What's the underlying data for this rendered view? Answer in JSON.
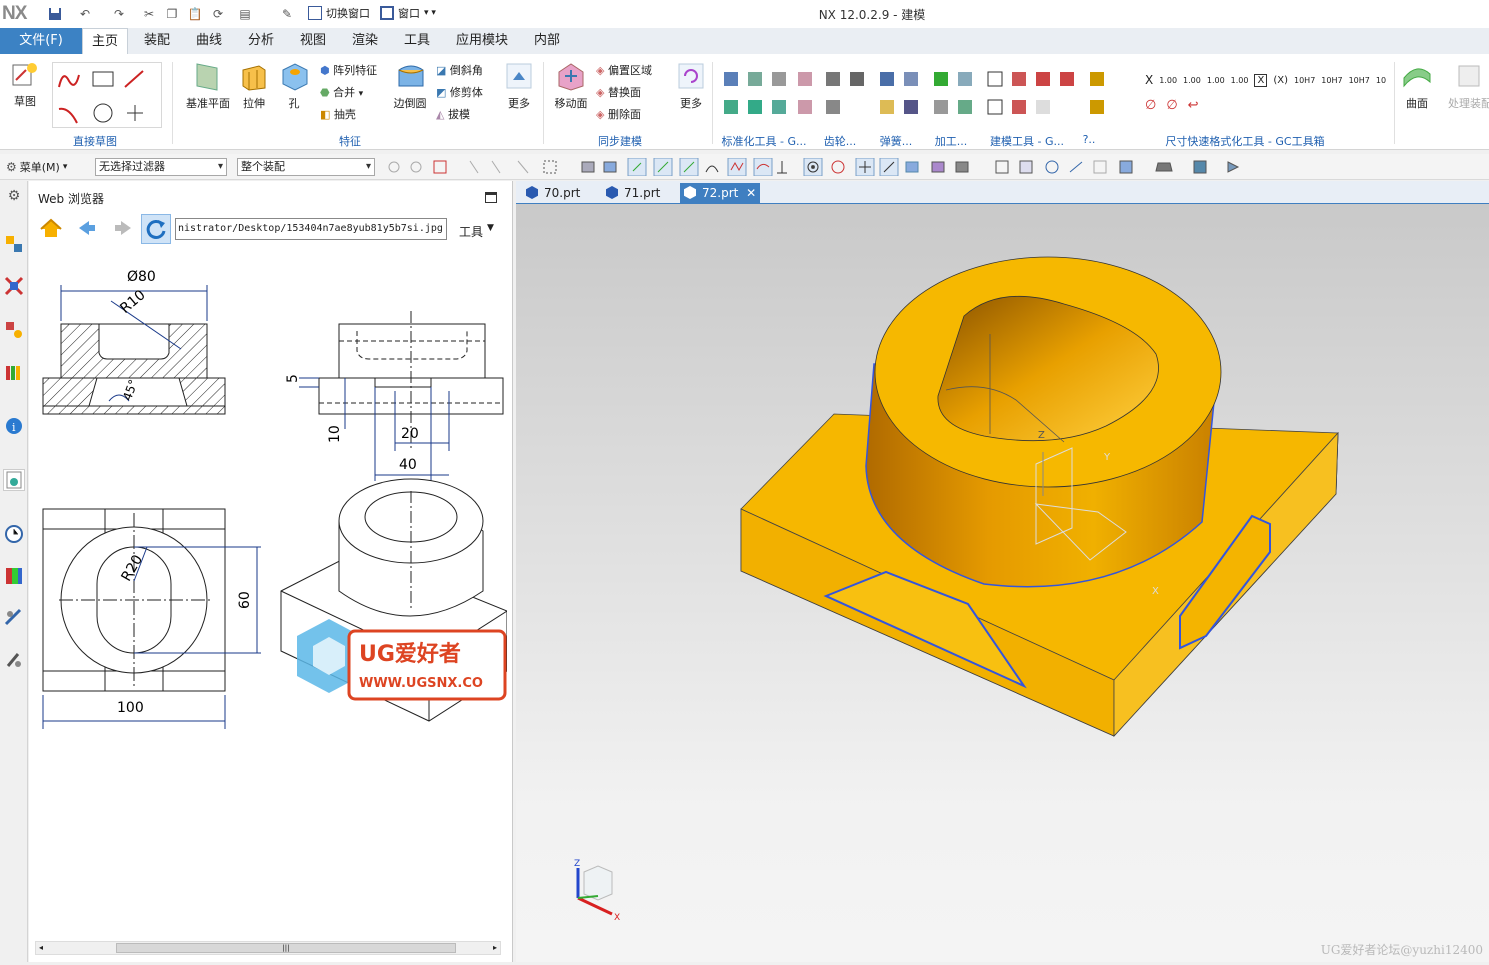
{
  "app": {
    "logo": "NX",
    "title": "NX 12.0.2.9 - 建模"
  },
  "quick_access": {
    "switch_window": "切换窗口",
    "window": "窗口"
  },
  "menu_tabs": [
    "文件(F)",
    "主页",
    "装配",
    "曲线",
    "分析",
    "视图",
    "渲染",
    "工具",
    "应用模块",
    "内部"
  ],
  "active_tab": "主页",
  "ribbon": {
    "sketch": "草图",
    "sketch_group": "直接草图",
    "datum_plane": "基准平面",
    "extrude": "拉伸",
    "hole": "孔",
    "pattern_feature": "阵列特征",
    "unite": "合并",
    "shell": "抽壳",
    "edge_blend": "边倒圆",
    "chamfer": "倒斜角",
    "trim_body": "修剪体",
    "draft": "拔模",
    "more1": "更多",
    "feature_group": "特征",
    "move_face": "移动面",
    "offset_region": "偏置区域",
    "replace_face": "替换面",
    "delete_face": "删除面",
    "more2": "更多",
    "sync_group": "同步建模",
    "std_tools": "标准化工具 - G...",
    "gear": "齿轮...",
    "spring": "弹簧...",
    "machining": "加工...",
    "modeling_tools": "建模工具 - G...",
    "misc": "?..",
    "dim_tools": "尺寸快速格式化工具 - GC工具箱",
    "surface": "曲面",
    "process": "处理装配",
    "dim_labels": [
      "1.00",
      "1.00",
      "1.00",
      "1.00",
      "10H7",
      "10H7",
      "10H7",
      "10"
    ]
  },
  "toolbar2": {
    "menu": "菜单(M)",
    "filter": "无选择过滤器",
    "assembly": "整个装配"
  },
  "browser": {
    "title": "Web 浏览器",
    "url": "nistrator/Desktop/153404n7ae8yub81y5b7si.jpg",
    "tools": "工具",
    "drawing": {
      "dia80": "Ø80",
      "r10": "R10",
      "deg45": "45°",
      "d5": "5",
      "d10": "10",
      "d20": "20",
      "d40": "40",
      "r20": "R20",
      "d60": "60",
      "d100": "100",
      "logo_text": "UG爱好者",
      "logo_url": "WWW.UGSNX.CO"
    }
  },
  "doc_tabs": [
    "70.prt",
    "71.prt",
    "72.prt"
  ],
  "active_doc": "72.prt",
  "axes": {
    "x": "X",
    "y": "Y",
    "z": "Z"
  },
  "watermark": "UG爱好者论坛@yuzhi12400",
  "colors": {
    "accent": "#3c82c4",
    "part": "#f5b800",
    "edge": "#3355dd"
  }
}
